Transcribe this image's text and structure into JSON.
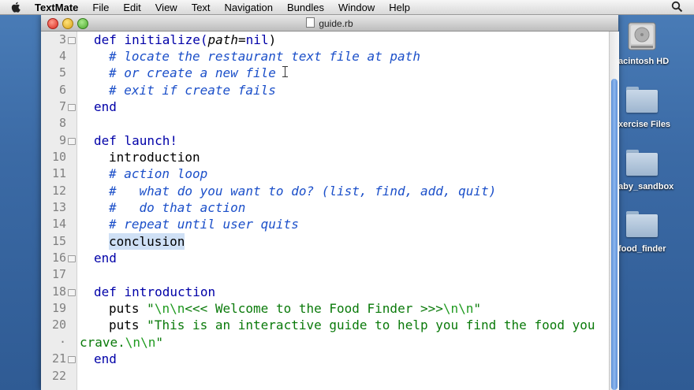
{
  "menubar": {
    "app_name": "TextMate",
    "items": [
      "File",
      "Edit",
      "View",
      "Text",
      "Navigation",
      "Bundles",
      "Window",
      "Help"
    ]
  },
  "desktop_icons": [
    {
      "label": "acintosh HD",
      "icon": "hard-drive-icon"
    },
    {
      "label": "xercise Files",
      "icon": "folder-icon"
    },
    {
      "label": "aby_sandbox",
      "icon": "folder-icon"
    },
    {
      "label": "food_finder",
      "icon": "folder-icon"
    }
  ],
  "window": {
    "title": "guide.rb"
  },
  "editor": {
    "lines": [
      {
        "num": "3",
        "fold": true
      },
      {
        "num": "4",
        "fold": false
      },
      {
        "num": "5",
        "fold": false
      },
      {
        "num": "6",
        "fold": false
      },
      {
        "num": "7",
        "fold": true
      },
      {
        "num": "8",
        "fold": false
      },
      {
        "num": "9",
        "fold": true
      },
      {
        "num": "10",
        "fold": false
      },
      {
        "num": "11",
        "fold": false
      },
      {
        "num": "12",
        "fold": false
      },
      {
        "num": "13",
        "fold": false
      },
      {
        "num": "14",
        "fold": false
      },
      {
        "num": "15",
        "fold": false
      },
      {
        "num": "16",
        "fold": true
      },
      {
        "num": "17",
        "fold": false
      },
      {
        "num": "18",
        "fold": true
      },
      {
        "num": "19",
        "fold": false
      },
      {
        "num": "20",
        "fold": false
      },
      {
        "num": "·",
        "fold": false
      },
      {
        "num": "21",
        "fold": true
      },
      {
        "num": "22",
        "fold": false
      }
    ],
    "code": {
      "l3_def": "def initialize(",
      "l3_param": "path",
      "l3_eq": "=",
      "l3_nil": "nil",
      "l3_close": ")",
      "l4": "# locate the restaurant text file at path",
      "l5": "# or create a new file",
      "l6": "# exit if create fails",
      "l7": "end",
      "l9": "def launch!",
      "l10": "introduction",
      "l11": "# action loop",
      "l12": "#   what do you want to do? (list, find, add, quit)",
      "l13": "#   do that action",
      "l14": "# repeat until user quits",
      "l15": "conclusion",
      "l16": "end",
      "l18": "def introduction",
      "l19_puts": "puts ",
      "l19_q1": "\"",
      "l19_esc1": "\\n\\n",
      "l19_text": "<<< Welcome to the Food Finder >>>",
      "l19_esc2": "\\n\\n",
      "l19_q2": "\"",
      "l20_puts": "puts ",
      "l20_text": "\"This is an interactive guide to help you find the food you",
      "l20b_text": "crave.",
      "l20b_esc": "\\n\\n",
      "l20b_q": "\"",
      "l21": "end"
    }
  },
  "colors": {
    "keyword": "#0000a8",
    "comment": "#1b4fc9",
    "string": "#0a7a0a",
    "selection": "#cfe0f5"
  }
}
